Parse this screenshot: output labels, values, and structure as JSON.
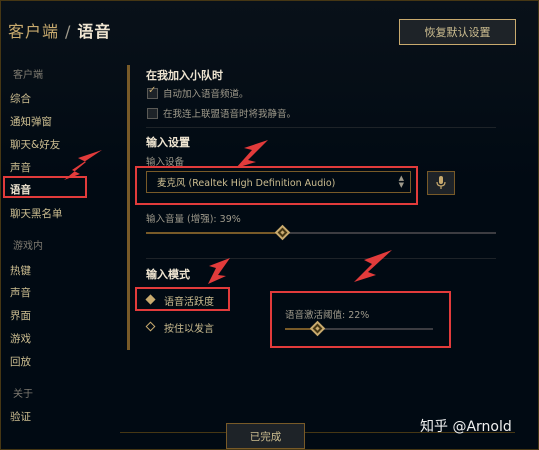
{
  "breadcrumb": {
    "root": "客户端",
    "separator": "/",
    "current": "语音"
  },
  "reset_button": "恢复默认设置",
  "sidebar": {
    "sections": [
      {
        "header": "客户端",
        "items": [
          "综合",
          "通知弹窗",
          "聊天&好友",
          "声音",
          "语音",
          "聊天黑名单"
        ]
      },
      {
        "header": "游戏内",
        "items": [
          "热键",
          "声音",
          "界面",
          "游戏",
          "回放"
        ]
      },
      {
        "header": "关于",
        "items": [
          "验证"
        ]
      }
    ],
    "active_item": "语音"
  },
  "party": {
    "title": "在我加入小队时",
    "options": [
      {
        "label": "自动加入语音频道。",
        "checked": true
      },
      {
        "label": "在我连上联盟语音时将我静音。",
        "checked": false
      }
    ]
  },
  "input_settings": {
    "title": "输入设置",
    "device_label": "输入设备",
    "device_value": "麦克风 (Realtek High Definition Audio)",
    "volume_label": "输入音量 (增强): 39%",
    "volume_level": 0.39
  },
  "input_mode": {
    "title": "输入模式",
    "options": [
      {
        "label": "语音活跃度",
        "selected": true
      },
      {
        "label": "按住以发言",
        "selected": false
      }
    ],
    "threshold_label": "语音激活阈值: 22%",
    "threshold_level": 0.22
  },
  "done_button": "已完成",
  "watermark": "知乎 @Arnold",
  "colors": {
    "gold": "#c8aa6e",
    "annotation_red": "#e23b3b",
    "background": "#010a13"
  },
  "icons": {
    "microphone": "microphone-icon",
    "select_arrows": "chevron-updown-icon"
  }
}
